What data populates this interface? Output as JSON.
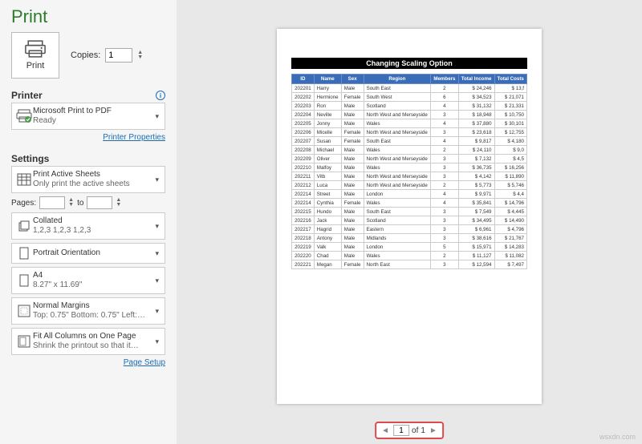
{
  "title": "Print",
  "copies": {
    "label": "Copies:",
    "value": "1"
  },
  "printBtn": "Print",
  "printerHead": "Printer",
  "printer": {
    "name": "Microsoft Print to PDF",
    "status": "Ready"
  },
  "printerProps": "Printer Properties",
  "settingsHead": "Settings",
  "settings": {
    "printWhat": {
      "label": "Print Active Sheets",
      "sub": "Only print the active sheets"
    },
    "pages": {
      "label": "Pages:",
      "to": "to"
    },
    "collate": {
      "label": "Collated",
      "sub": "1,2,3   1,2,3   1,2,3"
    },
    "orient": {
      "label": "Portrait Orientation"
    },
    "paper": {
      "label": "A4",
      "sub": "8.27\" x 11.69\""
    },
    "margins": {
      "label": "Normal Margins",
      "sub": "Top: 0.75\" Bottom: 0.75\" Left:…"
    },
    "scaling": {
      "label": "Fit All Columns on One Page",
      "sub": "Shrink the printout so that it…"
    }
  },
  "pageSetup": "Page Setup",
  "pager": {
    "current": "1",
    "of": "of",
    "total": "1"
  },
  "watermark": "wsxdn.com",
  "chart_data": {
    "type": "table",
    "title": "Changing Scaling Option",
    "columns": [
      "ID",
      "Name",
      "Sex",
      "Region",
      "Members",
      "Total Income",
      "Total Costs"
    ],
    "rows": [
      [
        "202201",
        "Harry",
        "Male",
        "South East",
        "2",
        "$ 24,246",
        "$ 13,f"
      ],
      [
        "202202",
        "Hermione",
        "Female",
        "South West",
        "6",
        "$ 34,523",
        "$ 21,071"
      ],
      [
        "202203",
        "Ron",
        "Male",
        "Scotland",
        "4",
        "$ 31,132",
        "$ 21,331"
      ],
      [
        "202204",
        "Neville",
        "Male",
        "North West and Merseyside",
        "3",
        "$ 18,948",
        "$ 10,750"
      ],
      [
        "202205",
        "Jonny",
        "Male",
        "Wales",
        "4",
        "$ 37,880",
        "$ 30,101"
      ],
      [
        "202206",
        "Micelle",
        "Female",
        "North West and Merseyside",
        "3",
        "$ 23,618",
        "$ 12,755"
      ],
      [
        "202207",
        "Susan",
        "Female",
        "South East",
        "4",
        "$ 9,817",
        "$ 4,180"
      ],
      [
        "202208",
        "Michael",
        "Male",
        "Wales",
        "2",
        "$ 24,110",
        "$ 9,0"
      ],
      [
        "202209",
        "Oliver",
        "Male",
        "North West and Merseyside",
        "3",
        "$ 7,132",
        "$ 4,5"
      ],
      [
        "202210",
        "Malfoy",
        "Male",
        "Wales",
        "3",
        "$ 36,735",
        "$ 16,256"
      ],
      [
        "202211",
        "Vitb",
        "Male",
        "North West and Merseyside",
        "3",
        "$ 4,142",
        "$ 11,890"
      ],
      [
        "202212",
        "Luca",
        "Male",
        "North West and Merseyside",
        "2",
        "$ 5,773",
        "$ 5,746"
      ],
      [
        "202214",
        "Street",
        "Male",
        "London",
        "4",
        "$ 9,971",
        "$ 4,4"
      ],
      [
        "202214",
        "Cynthia",
        "Female",
        "Wales",
        "4",
        "$ 35,841",
        "$ 14,796"
      ],
      [
        "202215",
        "Hundo",
        "Male",
        "South East",
        "3",
        "$ 7,549",
        "$ 4,445"
      ],
      [
        "202216",
        "Jack",
        "Male",
        "Scotland",
        "3",
        "$ 34,495",
        "$ 14,490"
      ],
      [
        "202217",
        "Hagrid",
        "Male",
        "Eastern",
        "3",
        "$ 6,961",
        "$ 4,796"
      ],
      [
        "202218",
        "Antony",
        "Male",
        "Midlands",
        "3",
        "$ 38,616",
        "$ 21,767"
      ],
      [
        "202219",
        "Valk",
        "Male",
        "London",
        "5",
        "$ 15,971",
        "$ 14,283"
      ],
      [
        "202220",
        "Chad",
        "Male",
        "Wales",
        "2",
        "$ 11,127",
        "$ 11,082"
      ],
      [
        "202221",
        "Megan",
        "Female",
        "North East",
        "3",
        "$ 12,594",
        "$ 7,497"
      ]
    ]
  }
}
